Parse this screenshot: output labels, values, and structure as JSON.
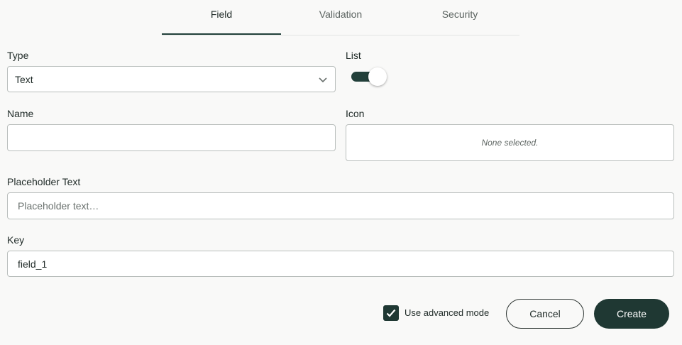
{
  "tabs": [
    {
      "label": "Field",
      "active": true
    },
    {
      "label": "Validation",
      "active": false
    },
    {
      "label": "Security",
      "active": false
    }
  ],
  "type": {
    "label": "Type",
    "value": "Text",
    "icon": "chevron-down-icon"
  },
  "list": {
    "label": "List",
    "enabled": true
  },
  "name": {
    "label": "Name",
    "value": ""
  },
  "icon": {
    "label": "Icon",
    "empty_text": "None selected."
  },
  "placeholder": {
    "label": "Placeholder Text",
    "placeholder": "Placeholder text…"
  },
  "key": {
    "label": "Key",
    "value": "field_1"
  },
  "advanced": {
    "label": "Use advanced mode",
    "checked": true
  },
  "actions": {
    "cancel": "Cancel",
    "create": "Create"
  },
  "colors": {
    "accent": "#22403a",
    "background": "#f9f9f8",
    "border": "#b9bebc"
  }
}
